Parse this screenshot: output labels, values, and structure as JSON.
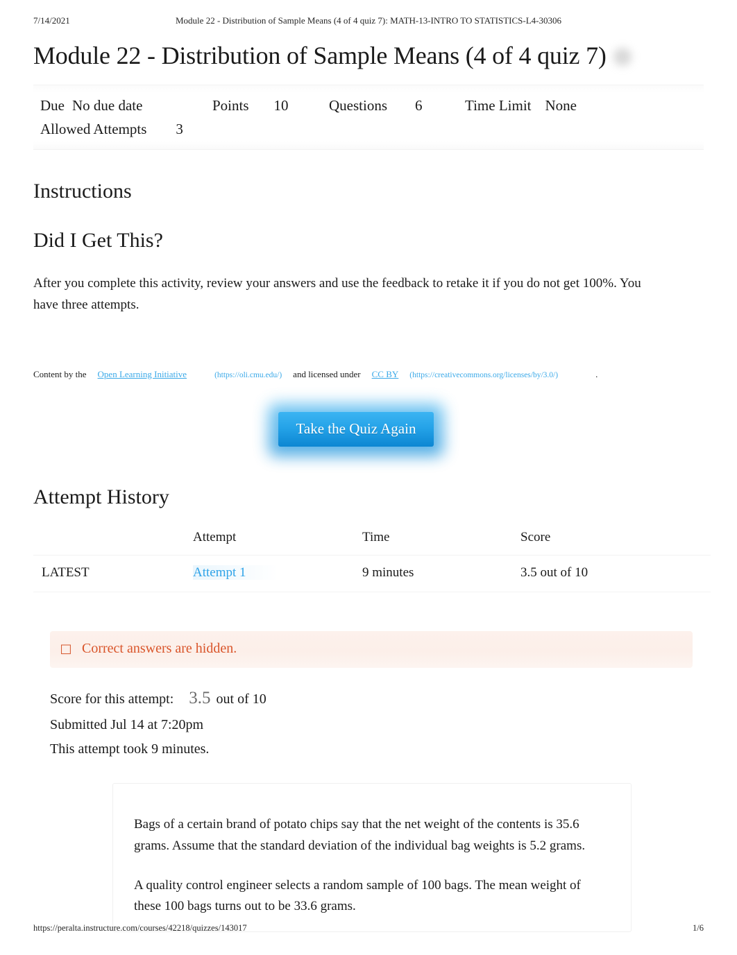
{
  "print_header": {
    "date": "7/14/2021",
    "title": "Module 22 - Distribution of Sample Means (4 of 4 quiz 7): MATH-13-INTRO TO STATISTICS-L4-30306"
  },
  "print_footer": {
    "url": "https://peralta.instructure.com/courses/42218/quizzes/143017",
    "page": "1/6"
  },
  "quiz": {
    "title": "Module 22 - Distribution of Sample Means (4 of 4 quiz 7)",
    "meta": {
      "due_label": "Due",
      "due_value": "No due date",
      "points_label": "Points",
      "points_value": "10",
      "questions_label": "Questions",
      "questions_value": "6",
      "time_limit_label": "Time Limit",
      "time_limit_value": "None",
      "allowed_attempts_label": "Allowed Attempts",
      "allowed_attempts_value": "3"
    }
  },
  "instructions": {
    "heading": "Instructions",
    "subheading": "Did I Get This?",
    "body": "After you complete this activity, review your answers and use the feedback to retake it if you do not get 100%. You have three attempts."
  },
  "attribution": {
    "prefix": "Content by the",
    "link1_text": "Open Learning Initiative",
    "link1_url": "(https://oli.cmu.edu/)",
    "middle": "and licensed under",
    "link2_text": "CC BY",
    "link2_url": "(https://creativecommons.org/licenses/by/3.0/)",
    "suffix": "."
  },
  "actions": {
    "take_quiz_again": "Take the Quiz Again"
  },
  "attempt_history": {
    "heading": "Attempt History",
    "columns": [
      "",
      "Attempt",
      "Time",
      "Score"
    ],
    "rows": [
      {
        "latest": "LATEST",
        "attempt": "Attempt 1",
        "time": "9 minutes",
        "score": "3.5 out of 10"
      }
    ]
  },
  "warning": {
    "icon": "tofu-box-icon",
    "glyph": "□",
    "text": "Correct answers are hidden.",
    "color": "#d9552a",
    "background": "#fcefe9"
  },
  "attempt_summary": {
    "score_label": "Score for this attempt:",
    "score_value": "3.5",
    "score_suffix": "out of 10",
    "submitted": "Submitted Jul 14 at 7:20pm",
    "duration": "This attempt took 9 minutes."
  },
  "question": {
    "paragraph_1": "Bags of a certain brand of potato chips say that the net weight of the contents is 35.6 grams. Assume that the standard deviation of the individual bag weights is 5.2 grams.",
    "paragraph_2": "A quality control engineer selects a random sample of 100 bags. The mean weight of these 100 bags turns out to be 33.6 grams."
  },
  "colors": {
    "link": "#3ba9e8",
    "button_top": "#3cb4f2",
    "button_bottom": "#0c86d2",
    "warning_text": "#d9552a"
  }
}
